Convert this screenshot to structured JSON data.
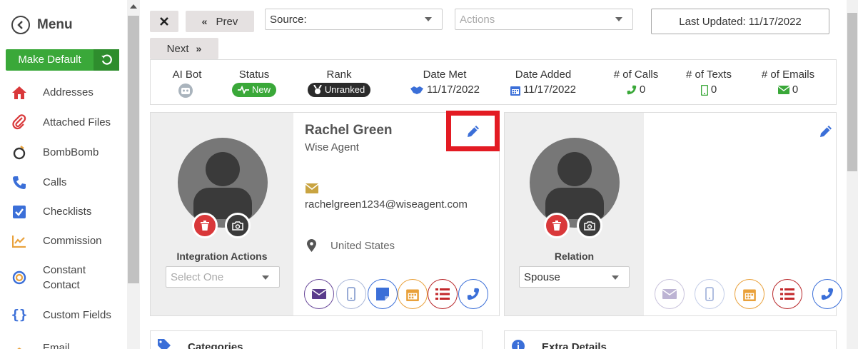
{
  "sidebar": {
    "menu_label": "Menu",
    "make_default_label": "Make Default",
    "items": [
      {
        "label": "Addresses",
        "icon": "home-icon",
        "color": "#d9383a"
      },
      {
        "label": "Attached Files",
        "icon": "paperclip-icon",
        "color": "#d9383a"
      },
      {
        "label": "BombBomb",
        "icon": "bombbomb-icon",
        "color": "#333333"
      },
      {
        "label": "Calls",
        "icon": "phone-icon",
        "color": "#3b6fd8"
      },
      {
        "label": "Checklists",
        "icon": "checkbox-icon",
        "color": "#3b6fd8"
      },
      {
        "label": "Commission",
        "icon": "chart-icon",
        "color": "#e9a13b"
      },
      {
        "label": "Constant",
        "label2": "Contact",
        "icon": "constant-contact-icon",
        "color": "#3b6fd8"
      },
      {
        "label": "Custom Fields",
        "icon": "braces-icon",
        "color": "#3b6fd8"
      },
      {
        "label": "Email",
        "icon": "email-icon",
        "color": "#e9a13b"
      }
    ]
  },
  "toolbar": {
    "close_icon": "close-icon",
    "prev_label": "Prev",
    "next_label": "Next",
    "source_label": "Source:",
    "actions_placeholder": "Actions",
    "last_updated": "Last Updated: 11/17/2022"
  },
  "stats": {
    "ai_bot_label": "AI Bot",
    "status_label": "Status",
    "status_value": "New",
    "rank_label": "Rank",
    "rank_value": "Unranked",
    "date_met_label": "Date Met",
    "date_met_value": "11/17/2022",
    "date_added_label": "Date Added",
    "date_added_value": "11/17/2022",
    "calls_label": "# of Calls",
    "calls_value": "0",
    "texts_label": "# of Texts",
    "texts_value": "0",
    "emails_label": "# of Emails",
    "emails_value": "0"
  },
  "contact": {
    "name": "Rachel Green",
    "company": "Wise Agent",
    "email": "rachelgreen1234@wiseagent.com",
    "location": "United States",
    "integration_label": "Integration Actions",
    "integration_placeholder": "Select One"
  },
  "relation": {
    "label": "Relation",
    "value": "Spouse"
  },
  "sections": {
    "categories": "Categories",
    "extra_details": "Extra Details"
  },
  "colors": {
    "green": "#3aa839",
    "blue": "#3b6fd8",
    "red": "#d9383a",
    "gold": "#c9a441",
    "highlight": "#e31b23"
  }
}
